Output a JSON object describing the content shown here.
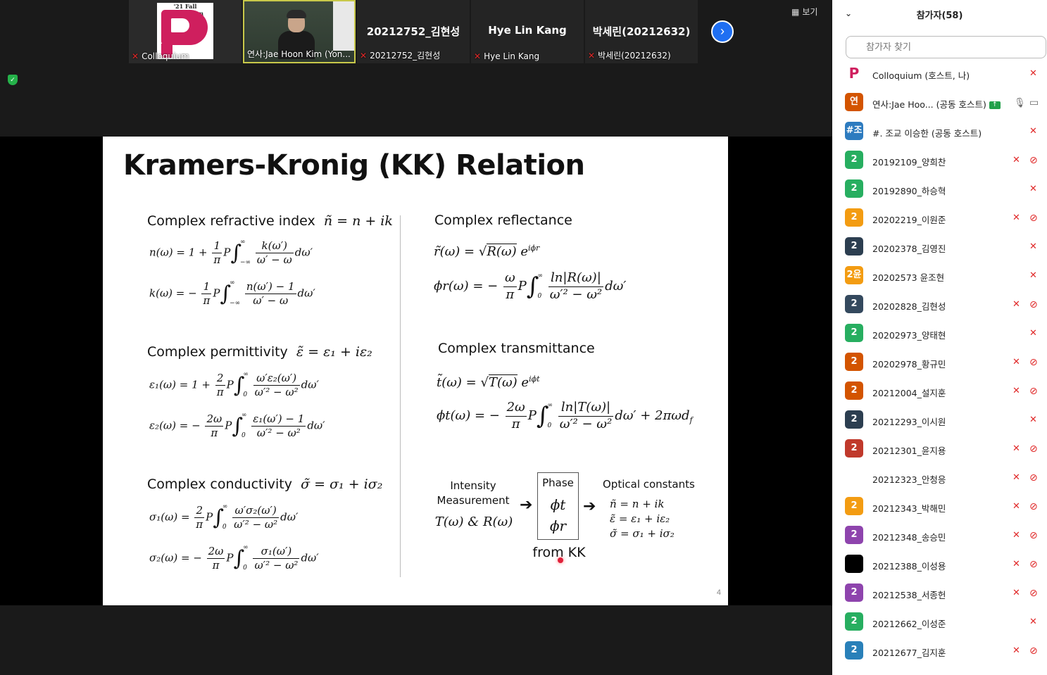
{
  "topbar": {
    "tiles": [
      {
        "kind": "logo",
        "logo_year": "'21 Fall Colloquium",
        "name": "Colloquium",
        "mic_muted": true
      },
      {
        "kind": "video",
        "name": "연사:Jae Hoon Kim (Yon...",
        "active": true
      },
      {
        "kind": "name",
        "big": "20212752_김현성",
        "name": "20212752_김현성",
        "mic_muted": true
      },
      {
        "kind": "name",
        "big": "Hye Lin Kang",
        "name": "Hye Lin Kang",
        "mic_muted": true
      },
      {
        "kind": "name",
        "big": "박세린(20212632)",
        "name": "박세린(20212632)",
        "mic_muted": true
      }
    ],
    "next_icon": "chevron-right-icon",
    "view_label": "보기"
  },
  "slide": {
    "title": "Kramers-Kronig (KK) Relation",
    "page_number": "4",
    "sections": {
      "refractive": {
        "label": "Complex refractive index",
        "formula": "ñ = n + ik"
      },
      "permittivity": {
        "label": "Complex permittivity",
        "formula": "ε̃ = ε₁ + iε₂"
      },
      "conductivity": {
        "label": "Complex conductivity",
        "formula": "σ̃ = σ₁ + iσ₂"
      },
      "reflectance": {
        "label": "Complex reflectance"
      },
      "transmittance": {
        "label": "Complex transmittance"
      }
    },
    "diagram": {
      "intensity_l1": "Intensity",
      "intensity_l2": "Measurement",
      "intensity_vars": "T(ω)  &  R(ω)",
      "phase_title": "Phase",
      "phase_t": "ϕt",
      "phase_r": "ϕr",
      "from_kk": "from KK",
      "optical_title": "Optical constants",
      "opt1": "ñ = n + ik",
      "opt2": "ε̃ = ε₁ + iε₂",
      "opt3": "σ̃ = σ₁ + iσ₂"
    }
  },
  "panel": {
    "title": "참가자(58)",
    "search_placeholder": "참가자 찾기",
    "participants": [
      {
        "avatar": "P",
        "color": "#ffffff",
        "name": "Colloquium (호스트, 나)",
        "mic": "muted",
        "cam": "none"
      },
      {
        "avatar": "연",
        "color": "#d35400",
        "name": "연사:Jae Hoo... (공동 호스트)",
        "mic": "on",
        "cam": "on",
        "sharing": true
      },
      {
        "avatar": "#조",
        "color": "#2d7bbf",
        "name": "#. 조교 이승한 (공동 호스트)",
        "mic": "muted",
        "cam": "none"
      },
      {
        "avatar": "2",
        "color": "#27ae60",
        "name": "20192109_양희찬",
        "mic": "muted",
        "cam": "off"
      },
      {
        "avatar": "2",
        "color": "#27ae60",
        "name": "20192890_하승혁",
        "mic": "muted",
        "cam": "none"
      },
      {
        "avatar": "2",
        "color": "#f39c12",
        "name": "20202219_이원준",
        "mic": "muted",
        "cam": "off"
      },
      {
        "avatar": "2",
        "color": "#2c3e50",
        "name": "20202378_김영진",
        "mic": "muted",
        "cam": "none"
      },
      {
        "avatar": "2윤",
        "color": "#f39c12",
        "name": "20202573 윤조현",
        "mic": "muted",
        "cam": "none"
      },
      {
        "avatar": "2",
        "color": "#34495e",
        "name": "20202828_김현성",
        "mic": "muted",
        "cam": "off"
      },
      {
        "avatar": "2",
        "color": "#27ae60",
        "name": "20202973_양태현",
        "mic": "muted",
        "cam": "none"
      },
      {
        "avatar": "2",
        "color": "#d35400",
        "name": "20202978_황규민",
        "mic": "muted",
        "cam": "off"
      },
      {
        "avatar": "2",
        "color": "#d35400",
        "name": "20212004_설지훈",
        "mic": "muted",
        "cam": "off"
      },
      {
        "avatar": "2",
        "color": "#2c3e50",
        "name": "20212293_이시원",
        "mic": "muted",
        "cam": "none"
      },
      {
        "avatar": "2",
        "color": "#c0392b",
        "name": "20212301_윤지용",
        "mic": "muted",
        "cam": "off"
      },
      {
        "avatar": "",
        "color": "#ffffff",
        "name": "20212323_안청응",
        "mic": "muted",
        "cam": "off"
      },
      {
        "avatar": "2",
        "color": "#f39c12",
        "name": "20212343_박해민",
        "mic": "muted",
        "cam": "off"
      },
      {
        "avatar": "2",
        "color": "#8e44ad",
        "name": "20212348_송승민",
        "mic": "muted",
        "cam": "off"
      },
      {
        "avatar": "",
        "color": "#000000",
        "name": "20212388_이성용",
        "mic": "muted",
        "cam": "off"
      },
      {
        "avatar": "2",
        "color": "#8e44ad",
        "name": "20212538_서종헌",
        "mic": "muted",
        "cam": "off"
      },
      {
        "avatar": "2",
        "color": "#27ae60",
        "name": "20212662_이성준",
        "mic": "muted",
        "cam": "none"
      },
      {
        "avatar": "2",
        "color": "#2980b9",
        "name": "20212677_김지훈",
        "mic": "muted",
        "cam": "off"
      }
    ]
  }
}
